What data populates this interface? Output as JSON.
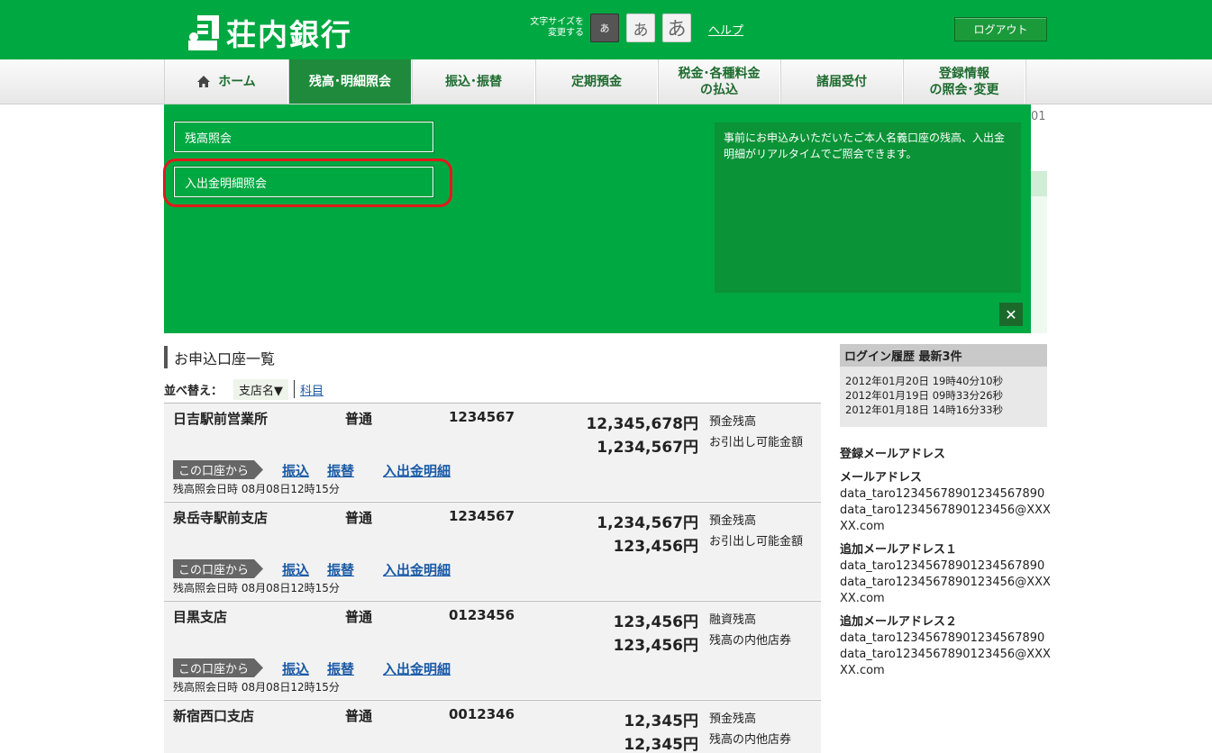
{
  "header": {
    "bank_name": "荘内銀行",
    "font_size_label_line1": "文字サイズを",
    "font_size_label_line2": "変更する",
    "font_small": "あ",
    "font_medium": "あ",
    "font_large": "あ",
    "help": "ヘルプ",
    "logout": "ログアウト"
  },
  "nav": {
    "home": "ホーム",
    "balance": "残高･明細照会",
    "transfer": "振込･振替",
    "time_deposit": "定期預金",
    "tax_line1": "税金･各種料金",
    "tax_line2": "の払込",
    "notices": "諸届受付",
    "reg_line1": "登録情報",
    "reg_line2": "の照会･変更"
  },
  "dropdown": {
    "balance_inquiry": "残高照会",
    "statement_inquiry": "入出金明細照会",
    "description": "事前にお申込みいただいたご本人名義口座の残高、入出金明細がリアルタイムでご照会できます。",
    "close": "✕"
  },
  "background_peek": "01",
  "accounts_section": {
    "title": "お申込口座一覧",
    "sort_label": "並べ替え：",
    "sort_branch": "支店名▼",
    "sort_subject": "科目"
  },
  "accounts": [
    {
      "branch": "日吉駅前営業所",
      "type": "普通",
      "number": "1234567",
      "amount1": "12,345,678円",
      "label1": "預金残高",
      "amount2": "1,234,567円",
      "label2": "お引出し可能金額",
      "from": "この口座から",
      "act1": "振込",
      "act2": "振替",
      "act3": "入出金明細",
      "date": "残高照会日時  08月08日12時15分"
    },
    {
      "branch": "泉岳寺駅前支店",
      "type": "普通",
      "number": "1234567",
      "amount1": "1,234,567円",
      "label1": "預金残高",
      "amount2": "123,456円",
      "label2": "お引出し可能金額",
      "from": "この口座から",
      "act1": "振込",
      "act2": "振替",
      "act3": "入出金明細",
      "date": "残高照会日時  08月08日12時15分"
    },
    {
      "branch": "目黒支店",
      "type": "普通",
      "number": "0123456",
      "amount1": "123,456円",
      "label1": "融資残高",
      "amount2": "123,456円",
      "label2": "残高の内他店券",
      "from": "この口座から",
      "act1": "振込",
      "act2": "振替",
      "act3": "入出金明細",
      "date": "残高照会日時  08月08日12時15分"
    },
    {
      "branch": "新宿西口支店",
      "type": "普通",
      "number": "0012346",
      "amount1": "12,345円",
      "label1": "預金残高",
      "amount2": "12,345円",
      "label2": "残高の内他店券"
    }
  ],
  "login_history": {
    "title": "ログイン履歴 最新3件",
    "entries": [
      "2012年01月20日 19時40分10秒",
      "2012年01月19日 09時33分26秒",
      "2012年01月18日 14時16分33秒"
    ]
  },
  "mail": {
    "title": "登録メールアドレス",
    "label0": "メールアドレス",
    "value0": "data_taro12345678901234567890data_taro1234567890123456@XXXXX.com",
    "label1": "追加メールアドレス１",
    "value1": "data_taro12345678901234567890data_taro1234567890123456@XXXXX.com",
    "label2": "追加メールアドレス２",
    "value2": "data_taro12345678901234567890data_taro1234567890123456@XXXXX.com"
  },
  "colors": {
    "brand_green": "#00a842",
    "nav_active": "#1f8a3b",
    "highlight_red": "#e01a1a",
    "link_blue": "#1a5aa6"
  }
}
